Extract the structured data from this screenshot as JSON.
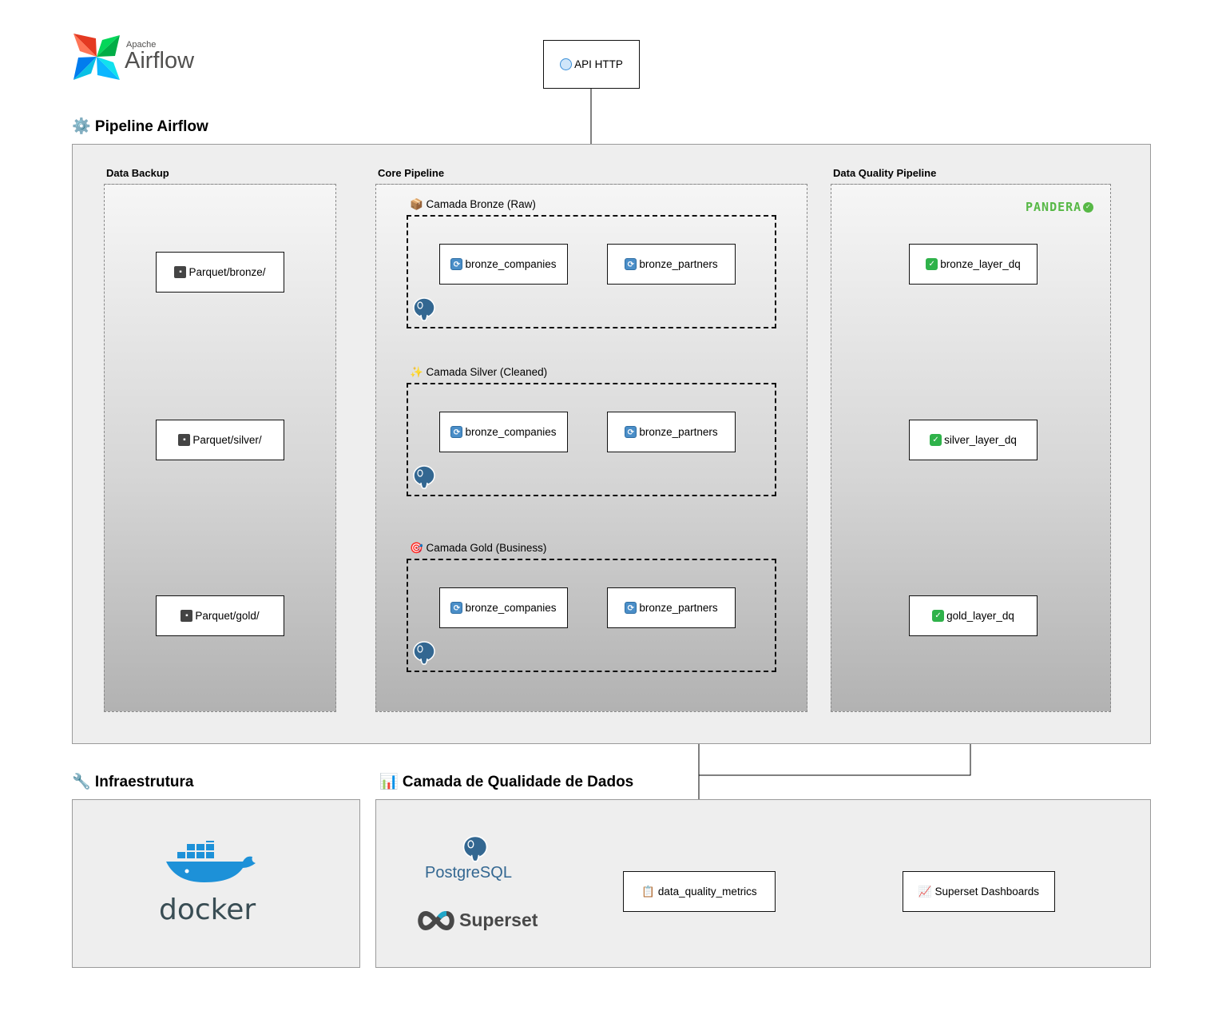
{
  "logos": {
    "airflow": {
      "top": "Apache",
      "main": "Airflow"
    },
    "pandera": "PANDERA",
    "postgres": "PostgreSQL",
    "superset": "Superset",
    "docker": "docker"
  },
  "api_node": {
    "icon": "globe-icon",
    "label": "API HTTP"
  },
  "pipeline": {
    "title": "⚙️ Pipeline Airflow",
    "columns": {
      "backup": "Data Backup",
      "core": "Core Pipeline",
      "quality": "Data Quality Pipeline"
    },
    "layers": [
      {
        "label": "📦 Camada Bronze (Raw)",
        "tasks": [
          "bronze_companies",
          "bronze_partners"
        ],
        "backup": "Parquet/bronze/",
        "dq": "bronze_layer_dq"
      },
      {
        "label": "✨ Camada Silver (Cleaned)",
        "tasks": [
          "bronze_companies",
          "bronze_partners"
        ],
        "backup": "Parquet/silver/",
        "dq": "silver_layer_dq"
      },
      {
        "label": "🎯 Camada Gold (Business)",
        "tasks": [
          "bronze_companies",
          "bronze_partners"
        ],
        "backup": "Parquet/gold/",
        "dq": "gold_layer_dq"
      }
    ]
  },
  "infra": {
    "title": "🔧 Infraestrutura"
  },
  "dq_layer": {
    "title": "📊 Camada de Qualidade de Dados",
    "metrics": "📋 data_quality_metrics",
    "dashboards": "📈 Superset Dashboards"
  },
  "colors": {
    "postgres_blue": "#336791",
    "docker_blue": "#1d91d8",
    "pandera_green": "#57b846",
    "airflow_red": "#e43921",
    "airflow_teal": "#00ad46"
  }
}
